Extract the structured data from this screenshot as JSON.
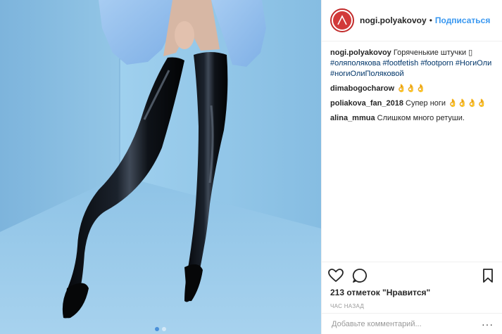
{
  "post": {
    "author": "nogi.polyakovoy",
    "separator": "•",
    "follow_label": "Подписаться",
    "caption": {
      "user": "nogi.polyakovoy",
      "text": "Горяченькие штучки ▯",
      "hashtags": [
        "#оляполякова",
        "#footfetish",
        "#footporn",
        "#НогиОли",
        "#ногиОлиПоляковой"
      ]
    },
    "comments": [
      {
        "user": "dimabogocharow",
        "text": "👌👌👌"
      },
      {
        "user": "poliakova_fan_2018",
        "text": "Супер ноги 👌👌👌👌"
      },
      {
        "user": "alina_mmua",
        "text": "Слишком много ретуши."
      }
    ],
    "likes": "213 отметок \"Нравится\"",
    "timestamp": "час назад",
    "comment_placeholder": "Добавьте комментарий...",
    "more_label": "···"
  },
  "icons": {
    "like": "heart-icon",
    "comment": "comment-icon",
    "save": "bookmark-icon",
    "more": "more-icon"
  },
  "carousel": {
    "count": 2,
    "active": 0
  },
  "colors": {
    "background_blue": "#8fc1e4",
    "follow_blue": "#3897f0",
    "hashtag_blue": "#003569",
    "muted": "#999999",
    "avatar_red": "#d23a3a"
  }
}
